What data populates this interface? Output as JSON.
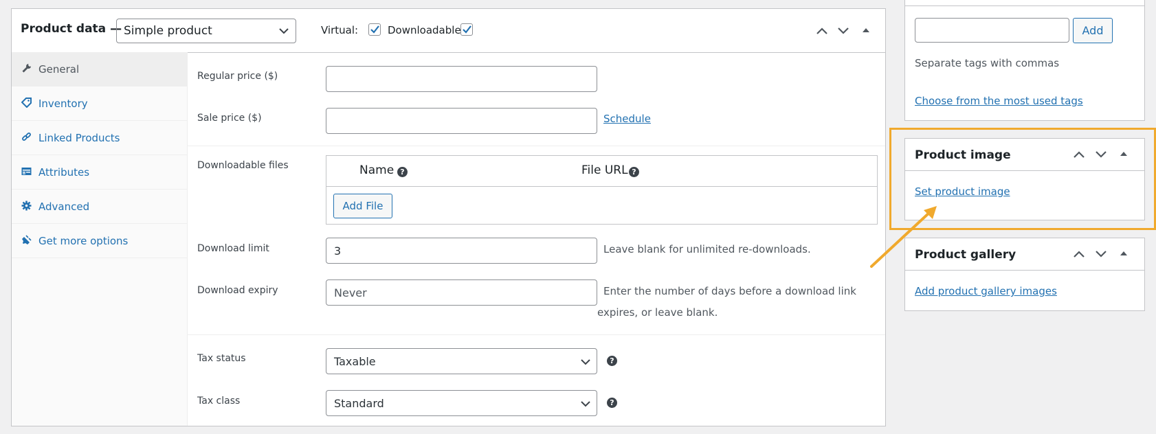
{
  "product_data": {
    "title": "Product data —",
    "type_selected": "Simple product",
    "virtual_label": "Virtual:",
    "virtual_checked": true,
    "downloadable_label": "Downloadable:",
    "downloadable_checked": true,
    "header_icons": [
      "move-up-icon",
      "move-down-icon",
      "collapse-toggle-icon"
    ]
  },
  "tabs": [
    {
      "label": "General",
      "icon": "wrench-icon",
      "active": true
    },
    {
      "label": "Inventory",
      "icon": "tag-icon",
      "active": false
    },
    {
      "label": "Linked Products",
      "icon": "link-icon",
      "active": false
    },
    {
      "label": "Attributes",
      "icon": "table-icon",
      "active": false
    },
    {
      "label": "Advanced",
      "icon": "gear-icon",
      "active": false
    },
    {
      "label": "Get more options",
      "icon": "plugin-icon",
      "active": false
    }
  ],
  "general": {
    "regular_price_label": "Regular price ($)",
    "regular_price_value": "",
    "sale_price_label": "Sale price ($)",
    "sale_price_value": "",
    "schedule_link": "Schedule",
    "downloadable_files_label": "Downloadable files",
    "files_table": {
      "col_name": "Name",
      "col_url": "File URL",
      "add_file_button": "Add File"
    },
    "download_limit_label": "Download limit",
    "download_limit_value": "3",
    "download_limit_desc": "Leave blank for unlimited re-downloads.",
    "download_expiry_label": "Download expiry",
    "download_expiry_placeholder": "Never",
    "download_expiry_desc_line1": "Enter the number of days before a download link",
    "download_expiry_desc_line2": "expires, or leave blank.",
    "tax_status_label": "Tax status",
    "tax_status_value": "Taxable",
    "tax_class_label": "Tax class",
    "tax_class_value": "Standard"
  },
  "sidebar": {
    "tags": {
      "add_button": "Add",
      "hint": "Separate tags with commas",
      "choose_link": "Choose from the most used tags"
    },
    "product_image": {
      "title": "Product image",
      "set_link": "Set product image"
    },
    "product_gallery": {
      "title": "Product gallery",
      "add_link": "Add product gallery images"
    }
  },
  "colors": {
    "accent": "#2271b1",
    "highlight": "#f0a92d",
    "background": "#f0f0f1",
    "border": "#c3c4c7"
  }
}
